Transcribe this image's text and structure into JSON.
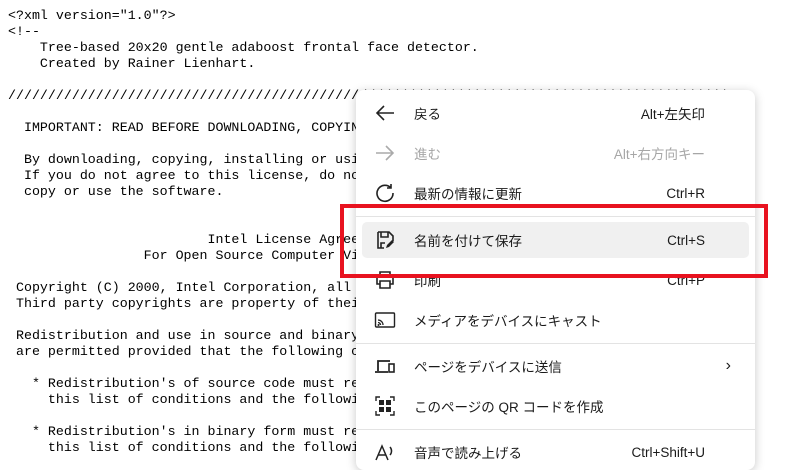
{
  "document": {
    "text": "<?xml version=\"1.0\"?>\n<!--\n    Tree-based 20x20 gentle adaboost frontal face detector.\n    Created by Rainer Lienhart.\n\n//////////////////////////////////////////////////////////////////////////////////////////\n\n  IMPORTANT: READ BEFORE DOWNLOADING, COPYING, INSTALLING OR USING.\n\n  By downloading, copying, installing or using the software you agree to this license.\n  If you do not agree to this license, do not download, install,\n  copy or use the software.\n\n\n                         Intel License Agreement\n                 For Open Source Computer Vision Library\n\n Copyright (C) 2000, Intel Corporation, all rights reserved.\n Third party copyrights are property of their respective owners.\n\n Redistribution and use in source and binary forms, with or without modification,\n are permitted provided that the following conditions are met:\n\n   * Redistribution's of source code must retain the above copyright notice,\n     this list of conditions and the following disclaimer.\n\n   * Redistribution's in binary form must reproduce the above copyright notice,\n     this list of conditions and the following disclaimer in the documentation"
  },
  "menu": {
    "back": {
      "label": "戻る",
      "shortcut": "Alt+左矢印",
      "icon": "arrow-left-icon"
    },
    "forward": {
      "label": "進む",
      "shortcut": "Alt+右方向キー",
      "icon": "arrow-right-icon"
    },
    "refresh": {
      "label": "最新の情報に更新",
      "shortcut": "Ctrl+R",
      "icon": "refresh-icon"
    },
    "save_as": {
      "label": "名前を付けて保存",
      "shortcut": "Ctrl+S",
      "icon": "save-icon"
    },
    "print": {
      "label": "印刷",
      "shortcut": "Ctrl+P",
      "icon": "print-icon"
    },
    "cast": {
      "label": "メディアをデバイスにキャスト",
      "icon": "cast-icon"
    },
    "send": {
      "label": "ページをデバイスに送信",
      "icon": "device-icon"
    },
    "qr": {
      "label": "このページの QR コードを作成",
      "icon": "qr-icon"
    },
    "read_aloud": {
      "label": "音声で読み上げる",
      "shortcut": "Ctrl+Shift+U",
      "icon": "read-aloud-icon"
    }
  },
  "colors": {
    "highlight_box": "#e8121f"
  }
}
